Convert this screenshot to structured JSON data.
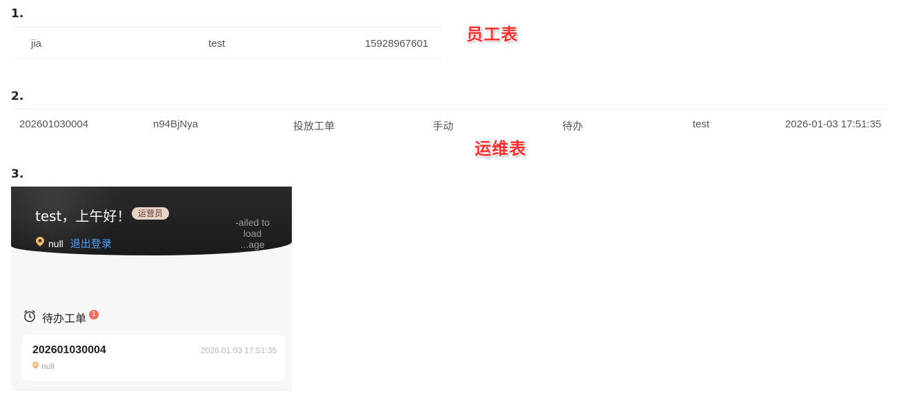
{
  "sections": [
    {
      "num": "1."
    },
    {
      "num": "2."
    },
    {
      "num": "3."
    }
  ],
  "staff_table": {
    "annotation": "员工表",
    "row": [
      "jia",
      "test",
      "15928967601"
    ]
  },
  "ops_table": {
    "annotation": "运维表",
    "row": [
      "202601030004",
      "n94BjNya",
      "投放工单",
      "手动",
      "待办",
      "test",
      "2026-01-03 17:51:35"
    ]
  },
  "phone": {
    "greeting": "test，上午好！",
    "role_badge": "运营员",
    "location": "null",
    "logout": "退出登录",
    "failed_image_text": "-ailed to load ...age",
    "todo_title": "待办工单",
    "todo_count": "1",
    "card": {
      "id": "202601030004",
      "time": "2026.01.03 17:51:35",
      "location": "null"
    }
  },
  "colors": {
    "annotation": "#ff2a2a",
    "hero_bg": "#1a1a1a",
    "badge_bg": "#e9d2c7",
    "link": "#4aa0ff",
    "pin": "#f2b56a",
    "notice_dot": "#f26a5b"
  },
  "icons": {
    "location": "location-pin-icon",
    "todo": "alarm-clock-icon"
  }
}
